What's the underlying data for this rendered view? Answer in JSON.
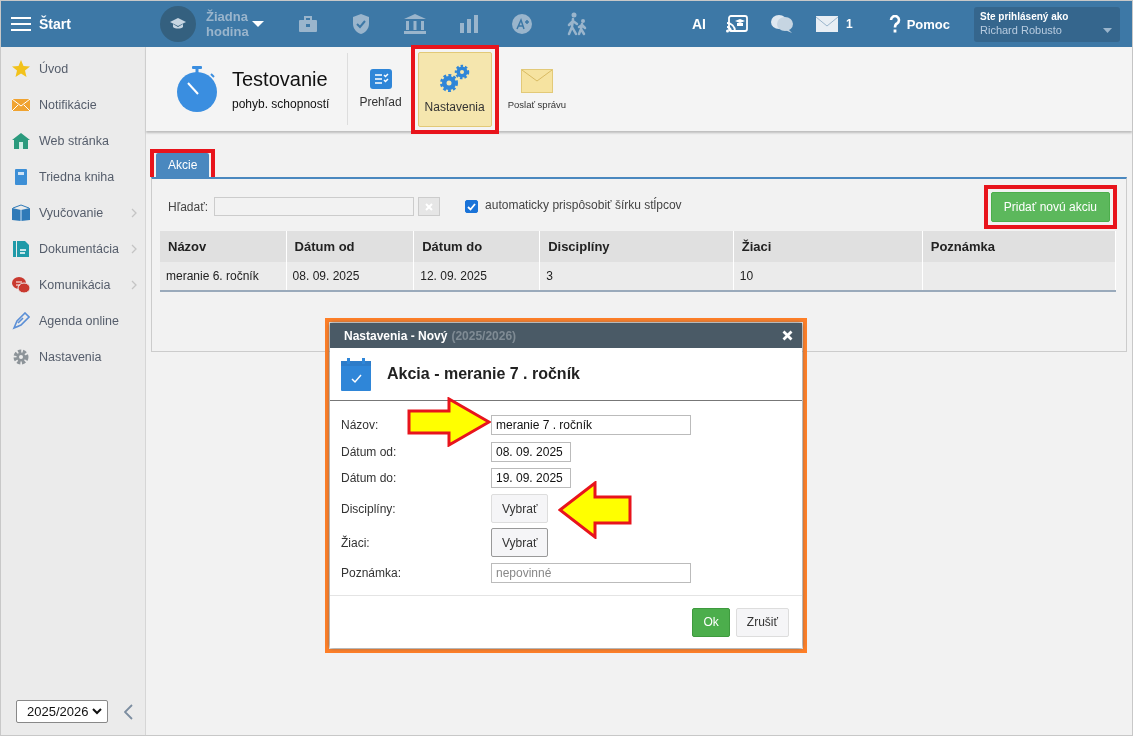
{
  "topbar": {
    "menu_label": "Štart",
    "lesson_label": "Žiadna hodina",
    "ai_label": "AI",
    "mail_count": "1",
    "help_label": "Pomoc",
    "user": {
      "caption": "Ste prihlásený ako",
      "name": "Richard Robusto"
    }
  },
  "sidebar": {
    "items": [
      {
        "label": "Úvod",
        "has_submenu": false
      },
      {
        "label": "Notifikácie",
        "has_submenu": false
      },
      {
        "label": "Web stránka",
        "has_submenu": false
      },
      {
        "label": "Triedna kniha",
        "has_submenu": false
      },
      {
        "label": "Vyučovanie",
        "has_submenu": true
      },
      {
        "label": "Dokumentácia",
        "has_submenu": true
      },
      {
        "label": "Komunikácia",
        "has_submenu": true
      },
      {
        "label": "Agenda online",
        "has_submenu": false
      },
      {
        "label": "Nastavenia",
        "has_submenu": false
      }
    ],
    "year_select": "2025/2026"
  },
  "module": {
    "title": "Testovanie",
    "subtitle": "pohyb. schopností",
    "actions": [
      {
        "label": "Prehľad",
        "selected": false,
        "highlighted": false
      },
      {
        "label": "Nastavenia",
        "selected": true,
        "highlighted": true
      },
      {
        "label": "Poslať správu",
        "selected": false,
        "highlighted": false
      }
    ]
  },
  "tabs": [
    {
      "label": "Akcie",
      "selected": true,
      "highlighted": true
    }
  ],
  "toolbar": {
    "search_label": "Hľadať:",
    "auto_width": {
      "label": "automaticky prispôsobiť šírku stĺpcov",
      "checked": true
    },
    "add_button": {
      "label": "Pridať novú akciu",
      "highlighted": true
    }
  },
  "table": {
    "columns": [
      "Názov",
      "Dátum od",
      "Dátum do",
      "Disciplíny",
      "Žiaci",
      "Poznámka"
    ],
    "rows": [
      [
        "meranie 6. ročník",
        "08. 09. 2025",
        "12. 09. 2025",
        "3",
        "10",
        ""
      ]
    ]
  },
  "dialog": {
    "title": "Nastavenia - Nový",
    "year": "(2025/2026)",
    "heading": "Akcia - meranie 7 . ročník",
    "highlighted": true,
    "fields": [
      {
        "label": "Názov:",
        "kind": "text",
        "value": "meranie 7 . ročník",
        "arrow_from_left": true
      },
      {
        "label": "Dátum od:",
        "kind": "date",
        "value": "08. 09. 2025"
      },
      {
        "label": "Dátum do:",
        "kind": "date",
        "value": "19. 09. 2025"
      },
      {
        "label": "Disciplíny:",
        "kind": "button",
        "button": "Vybrať",
        "focused": false,
        "arrow_from_right": true
      },
      {
        "label": "Žiaci:",
        "kind": "button",
        "button": "Vybrať",
        "focused": true
      },
      {
        "label": "Poznámka:",
        "kind": "text",
        "placeholder": "nepovinné"
      }
    ],
    "buttons": [
      {
        "label": "Ok",
        "kind": "primary"
      },
      {
        "label": "Zrušiť",
        "kind": "default"
      }
    ]
  }
}
